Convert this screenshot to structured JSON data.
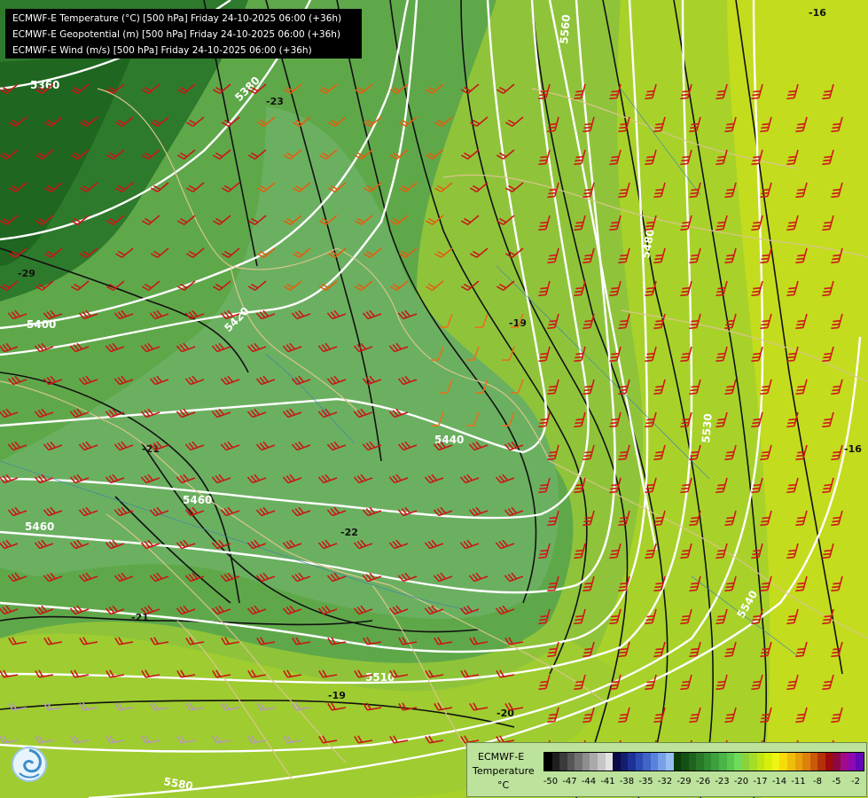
{
  "header": {
    "lines": [
      "ECMWF-E Temperature (°C) [500 hPa] Friday 24-10-2025 06:00 (+36h)",
      "ECMWF-E Geopotential (m) [500 hPa] Friday 24-10-2025 06:00 (+36h)",
      "ECMWF-E Wind (m/s) [500 hPa] Friday 24-10-2025 06:00 (+36h)"
    ]
  },
  "legend": {
    "model": "ECMWF-E",
    "variable": "Temperature",
    "unit": "°C",
    "colors": [
      "#000000",
      "#1e1e1e",
      "#3a3a3a",
      "#565656",
      "#727272",
      "#8e8e8e",
      "#aaaaaa",
      "#c6c6c6",
      "#e2e2e2",
      "#0a0a46",
      "#141e6e",
      "#1e3296",
      "#2d4bb4",
      "#4164c8",
      "#5a82dc",
      "#78a0e6",
      "#96bef0",
      "#0a3c0a",
      "#145014",
      "#1e641e",
      "#287828",
      "#328c32",
      "#3ca03c",
      "#4bb446",
      "#5ac850",
      "#6edc5a",
      "#8cd23c",
      "#a5dc28",
      "#bee614",
      "#d7f00a",
      "#f0f514",
      "#f5dc0a",
      "#f0be0a",
      "#e6a00a",
      "#dc820a",
      "#c85a0a",
      "#b4320a",
      "#a00a0a",
      "#8c0a3c",
      "#a00a8c",
      "#8c0ab4",
      "#640ab4"
    ],
    "ticks": [
      "-50",
      "-47",
      "-44",
      "-41",
      "-38",
      "-35",
      "-32",
      "-29",
      "-26",
      "-23",
      "-20",
      "-17",
      "-14",
      "-11",
      "-8",
      "-5",
      "-2"
    ]
  },
  "map": {
    "geopotential_labels": [
      "5360",
      "5380",
      "5400",
      "5420",
      "5440",
      "5460",
      "5460",
      "5480",
      "5510",
      "5530",
      "5540",
      "5560",
      "5580"
    ],
    "temperature_labels": [
      "-29",
      "-23",
      "-21",
      "-22",
      "-21",
      "-20",
      "-19",
      "-19",
      "-16",
      "-16"
    ]
  }
}
